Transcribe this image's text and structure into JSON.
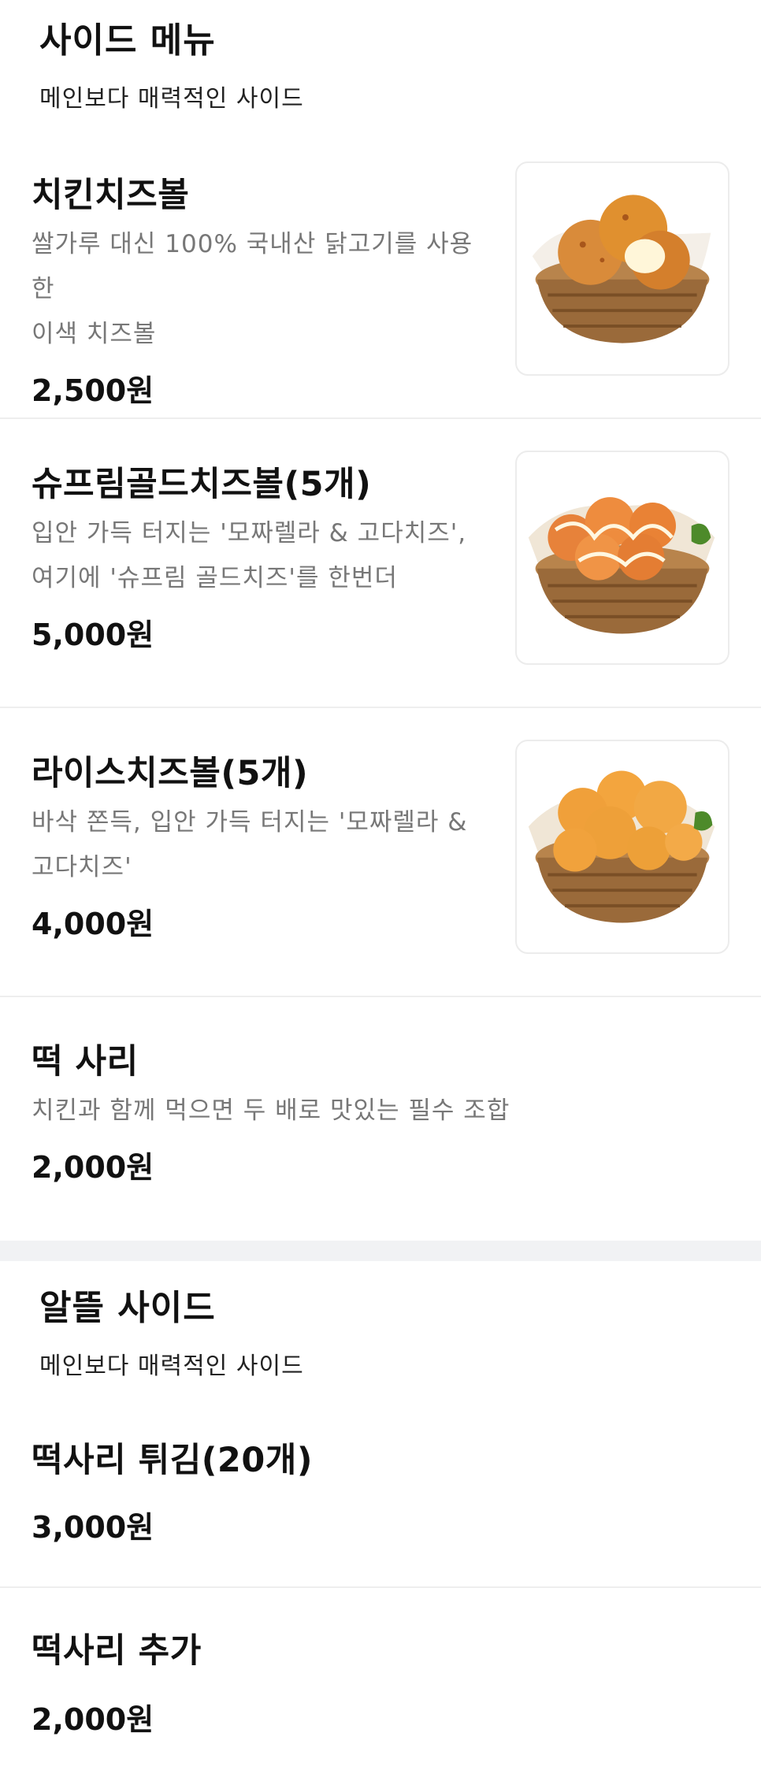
{
  "sections": [
    {
      "title": "사이드 메뉴",
      "subtitle": "메인보다 매력적인 사이드",
      "items": [
        {
          "name": "치킨치즈볼",
          "desc_lines": [
            "쌀가루 대신 100% 국내산 닭고기를 사용한",
            "이색 치즈볼"
          ],
          "price": "2,500원",
          "image_icon": "chicken-cheese-ball-photo"
        },
        {
          "name": "슈프림골드치즈볼(5개)",
          "desc_lines": [
            "입안 가득 터지는 '모짜렐라 & 고다치즈',",
            "여기에 '슈프림 골드치즈'를 한번더"
          ],
          "price": "5,000원",
          "image_icon": "supreme-gold-cheese-ball-photo"
        },
        {
          "name": "라이스치즈볼(5개)",
          "desc_lines": [
            "바삭 쫀득, 입안 가득 터지는 '모짜렐라 &",
            "고다치즈'"
          ],
          "price": "4,000원",
          "image_icon": "rice-cheese-ball-photo"
        },
        {
          "name": "떡 사리",
          "desc_lines": [
            "치킨과 함께 먹으면 두 배로 맛있는 필수 조합"
          ],
          "price": "2,000원"
        }
      ]
    },
    {
      "title": "알뜰 사이드",
      "subtitle": "메인보다 매력적인 사이드",
      "items": [
        {
          "name": "떡사리 튀김(20개)",
          "price": "3,000원"
        },
        {
          "name": "떡사리 추가",
          "price": "2,000원"
        }
      ]
    }
  ],
  "colors": {
    "title": "#111111",
    "description": "#777777",
    "divider": "#eeeeee",
    "section_gap": "#f1f2f4",
    "basket": "#9a6a3a",
    "fried": "#e0902f"
  }
}
